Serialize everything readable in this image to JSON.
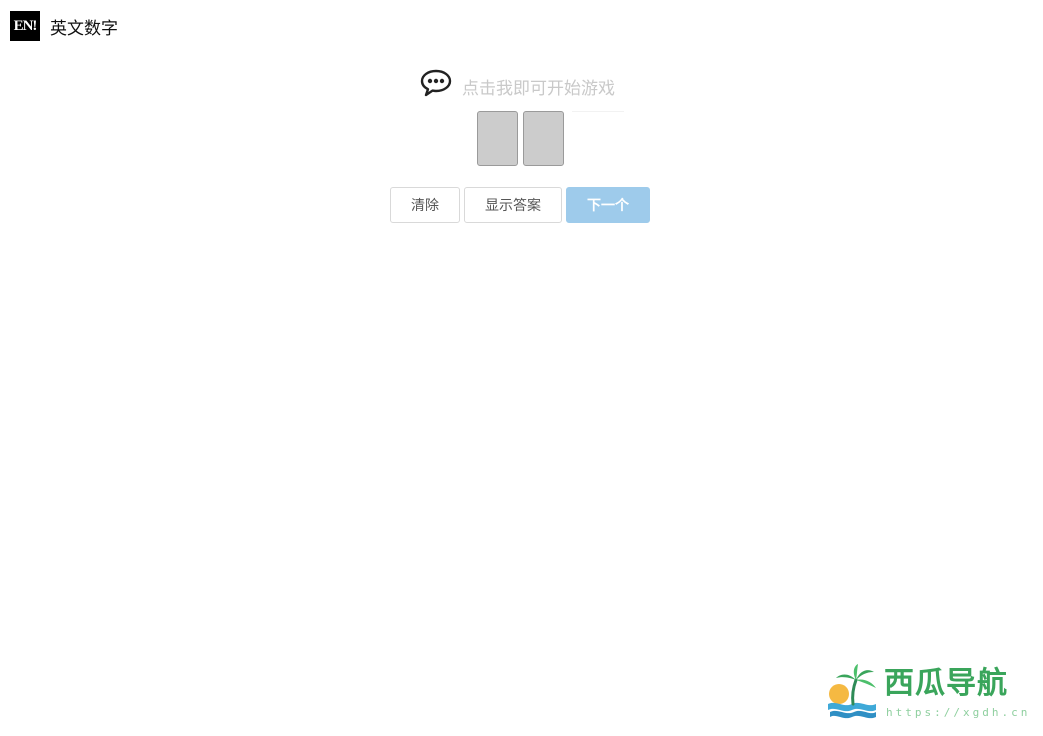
{
  "header": {
    "logo_text": "EN!",
    "title": "英文数字"
  },
  "prompt": {
    "icon": "chat-bubble-icon",
    "text": "点击我即可开始游戏"
  },
  "letter_boxes": [
    "",
    ""
  ],
  "buttons": {
    "clear_label": "清除",
    "show_answer_label": "显示答案",
    "next_label": "下一个"
  },
  "watermark": {
    "brand": "西瓜导航",
    "url": "https://xgdh.cn"
  },
  "colors": {
    "next_button_bg": "#9ecbeb",
    "letter_box_bg": "#cccccc",
    "prompt_text": "#c9c9c9",
    "watermark_green": "#3aa55b"
  }
}
